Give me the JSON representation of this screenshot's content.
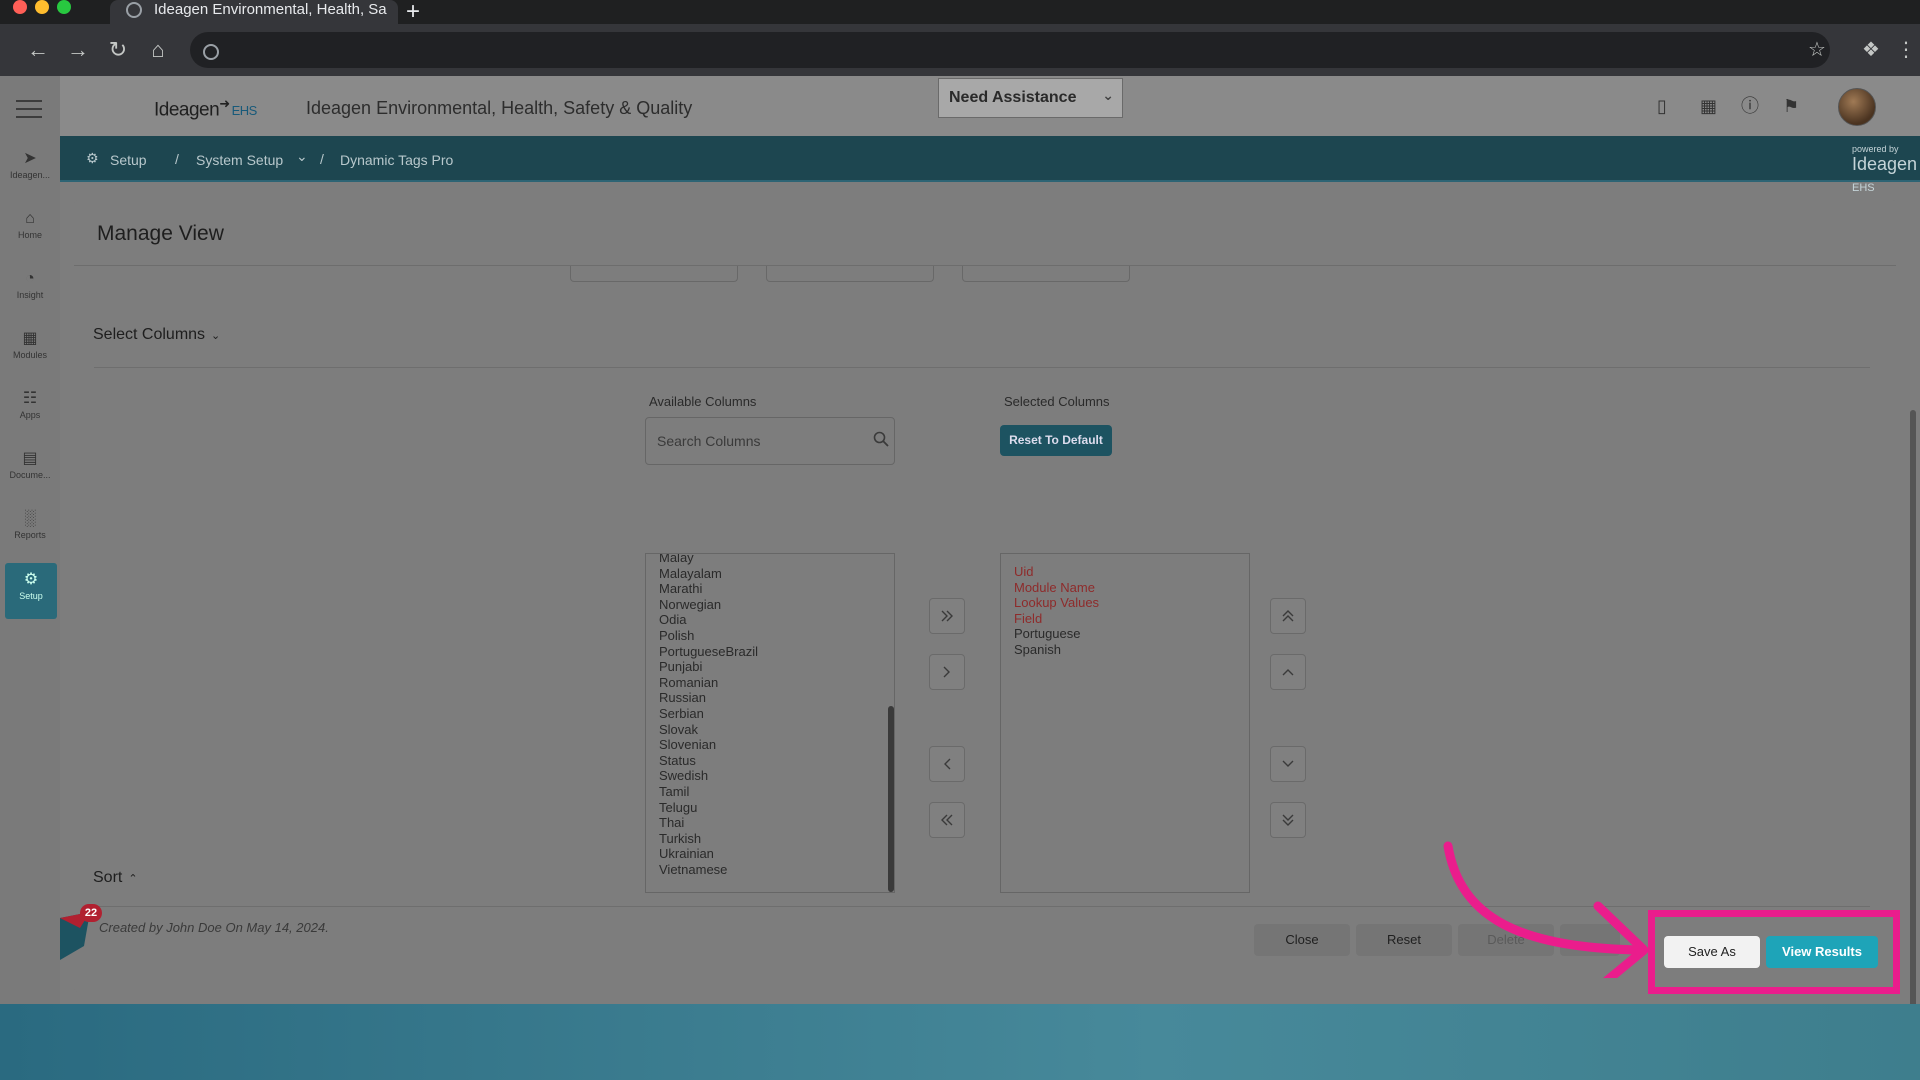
{
  "browser": {
    "tab_title": "Ideagen Environmental, Health, Sa",
    "new_tab": "+"
  },
  "header": {
    "logo": "Ideagen",
    "logo_suffix": "EHS",
    "app_title": "Ideagen Environmental, Health, Safety & Quality",
    "assistance_select": "Need Assistance"
  },
  "left_nav": [
    {
      "label": "Ideagen...",
      "icon": "ideagen-icon"
    },
    {
      "label": "Home",
      "icon": "home-icon"
    },
    {
      "label": "Insight",
      "icon": "insight-icon"
    },
    {
      "label": "Modules",
      "icon": "modules-icon"
    },
    {
      "label": "Apps",
      "icon": "apps-icon"
    },
    {
      "label": "Docume...",
      "icon": "document-icon"
    },
    {
      "label": "Reports",
      "icon": "reports-icon"
    },
    {
      "label": "Setup",
      "icon": "setup-icon"
    }
  ],
  "breadcrumb": {
    "items": [
      "Setup",
      "System Setup",
      "Dynamic Tags Pro"
    ],
    "powered_by": "powered by",
    "brand": "Ideagen",
    "brand_suffix": "EHS"
  },
  "modal": {
    "title": "Manage View",
    "select_columns": "Select Columns",
    "sort": "Sort",
    "available_label": "Available Columns",
    "selected_label": "Selected Columns",
    "search_placeholder": "Search Columns",
    "reset_default": "Reset To Default",
    "available_columns": [
      "Malay",
      "Malayalam",
      "Marathi",
      "Norwegian",
      "Odia",
      "Polish",
      "PortugueseBrazil",
      "Punjabi",
      "Romanian",
      "Russian",
      "Serbian",
      "Slovak",
      "Slovenian",
      "Status",
      "Swedish",
      "Tamil",
      "Telugu",
      "Thai",
      "Turkish",
      "Ukrainian",
      "Vietnamese"
    ],
    "selected_columns": [
      {
        "label": "Uid",
        "required": true
      },
      {
        "label": "Module Name",
        "required": true
      },
      {
        "label": "Lookup Values",
        "required": true
      },
      {
        "label": "Field",
        "required": true
      },
      {
        "label": "Portuguese",
        "required": false
      },
      {
        "label": "Spanish",
        "required": false
      }
    ],
    "footnote": "Created by John Doe On May 14, 2024.",
    "buttons": {
      "close": "Close",
      "reset": "Reset",
      "delete": "Delete",
      "save_as": "Save As",
      "view_results": "View Results"
    }
  },
  "notification_badge": "22",
  "colors": {
    "highlight": "#ea1d8c",
    "primary": "#1ea4b8",
    "breadcrumb_bar": "#1d4650",
    "required_column": "#8e2b2b"
  }
}
